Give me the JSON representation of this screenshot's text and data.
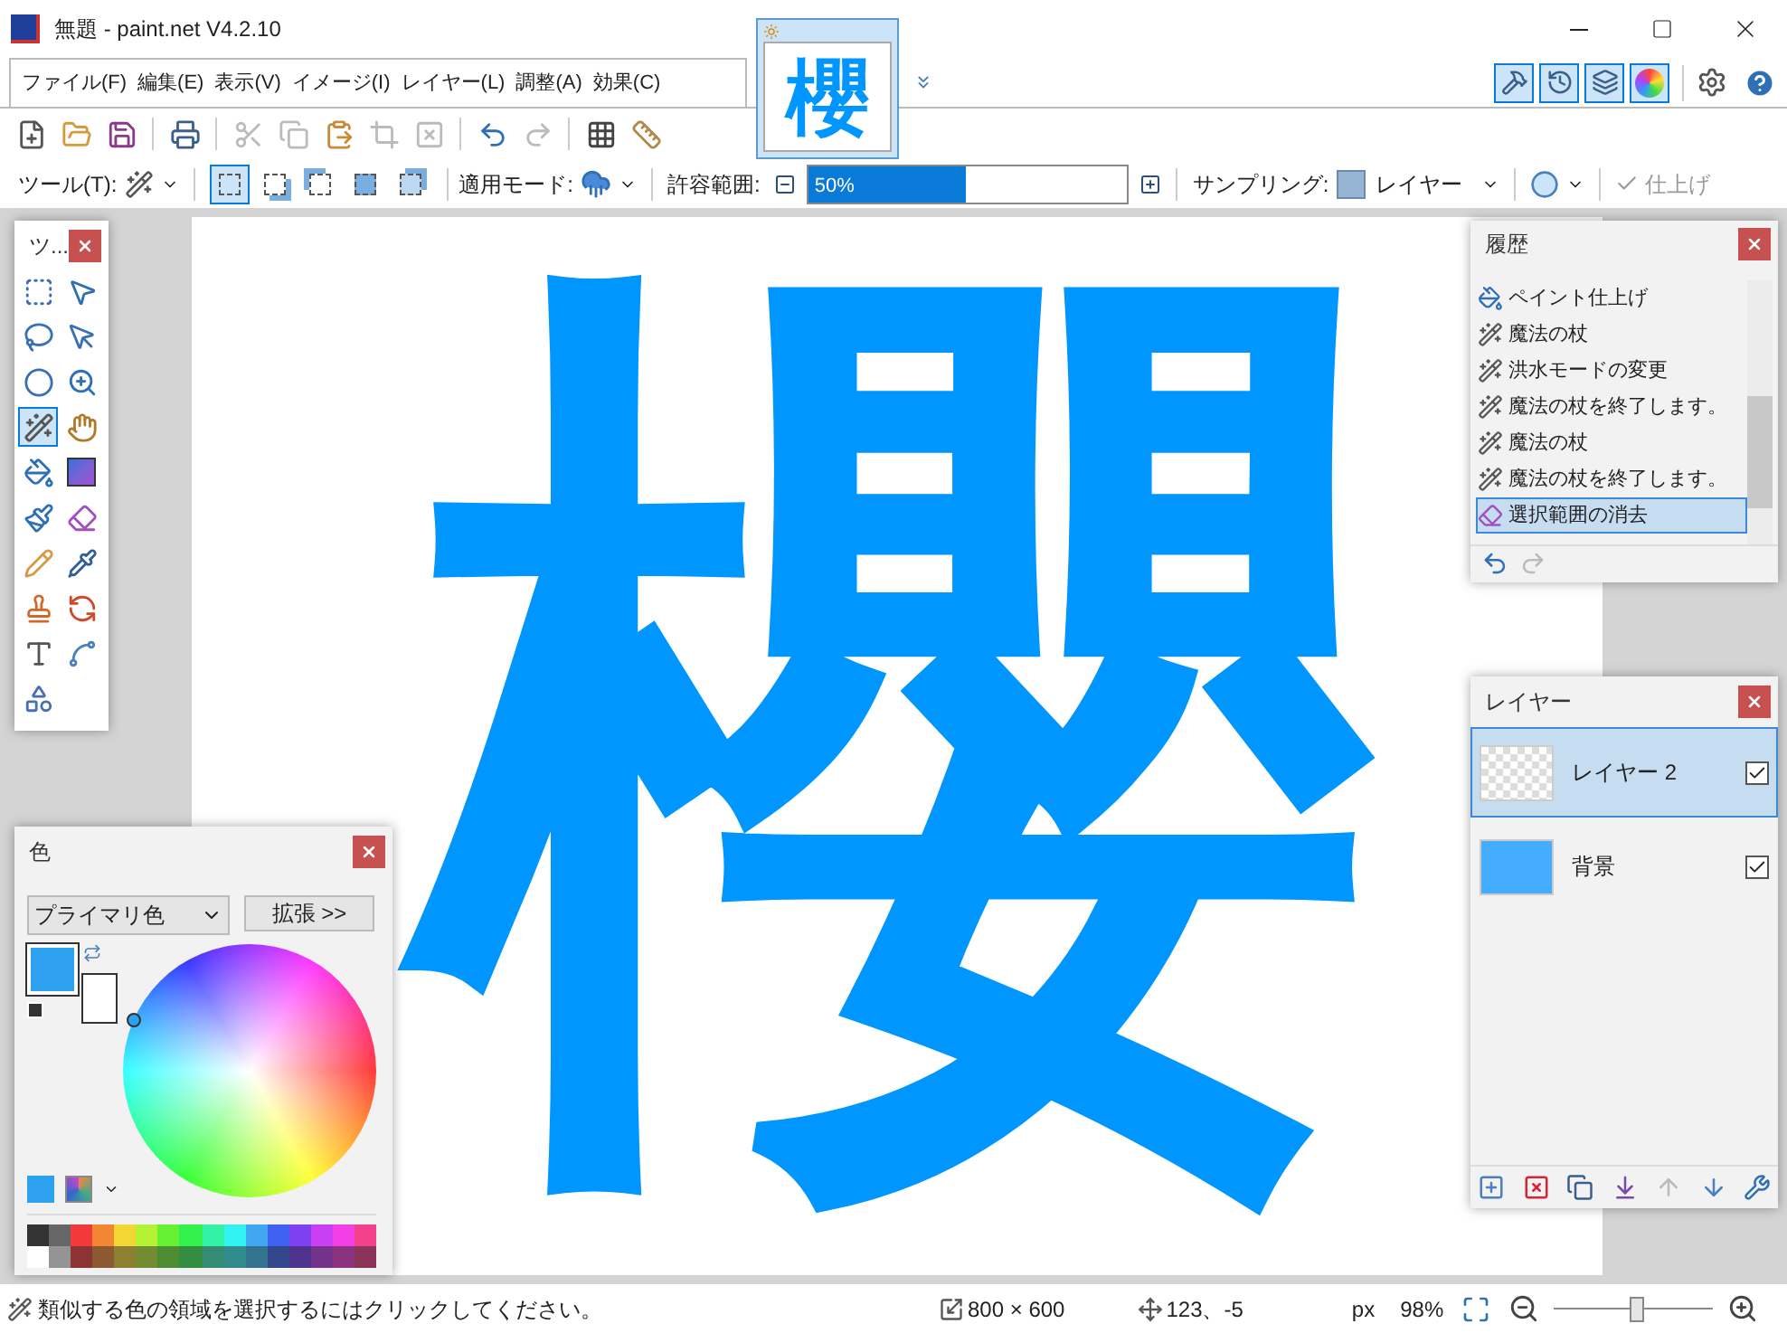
{
  "window": {
    "title": "無題 - paint.net V4.2.10"
  },
  "menu": [
    "ファイル(F)",
    "編集(E)",
    "表示(V)",
    "イメージ(I)",
    "レイヤー(L)",
    "調整(A)",
    "効果(C)"
  ],
  "image_tabs": [
    {
      "glyph": "櫻",
      "selected": true,
      "unsaved": true
    }
  ],
  "panel_toggles": [
    {
      "kind": "tools",
      "selected": true
    },
    {
      "kind": "history",
      "selected": true
    },
    {
      "kind": "layers",
      "selected": true
    },
    {
      "kind": "colors",
      "selected": true
    }
  ],
  "toolbar": [
    {
      "kind": "new",
      "disabled": false
    },
    {
      "kind": "open",
      "disabled": false
    },
    {
      "kind": "save",
      "disabled": false
    },
    {
      "kind": "print",
      "disabled": false
    },
    {
      "kind": "cut",
      "disabled": true
    },
    {
      "kind": "copy",
      "disabled": true
    },
    {
      "kind": "paste",
      "disabled": false
    },
    {
      "kind": "crop",
      "disabled": true
    },
    {
      "kind": "deselect",
      "disabled": true
    },
    {
      "kind": "undo",
      "disabled": false
    },
    {
      "kind": "redo",
      "disabled": true
    },
    {
      "kind": "grid",
      "disabled": false
    },
    {
      "kind": "ruler",
      "disabled": false
    }
  ],
  "options_bar": {
    "tool_label": "ツール(T):",
    "selection_modes": [
      {
        "kind": "replace",
        "selected": true
      },
      {
        "kind": "union",
        "selected": false
      },
      {
        "kind": "exclude",
        "selected": false
      },
      {
        "kind": "intersect",
        "selected": false
      },
      {
        "kind": "xor",
        "selected": false
      }
    ],
    "flood_mode_label": "適用モード:",
    "tolerance_label": "許容範囲:",
    "tolerance": {
      "level": 0.49,
      "reading": "50%"
    },
    "sampling_label": "サンプリング:",
    "sampling_value": "レイヤー",
    "finish": {
      "label": "仕上げ",
      "disabled": true
    }
  },
  "canvas": {
    "glyph": "櫻"
  },
  "tools_panel": {
    "title": "ツ...",
    "tools": [
      {
        "kind": "rect-select",
        "selected": false
      },
      {
        "kind": "move-pixels",
        "selected": false
      },
      {
        "kind": "lasso",
        "selected": false
      },
      {
        "kind": "move-selection",
        "selected": false
      },
      {
        "kind": "ellipse-select",
        "selected": false
      },
      {
        "kind": "zoom",
        "selected": false
      },
      {
        "kind": "magic-wand",
        "selected": true
      },
      {
        "kind": "pan",
        "selected": false
      },
      {
        "kind": "bucket",
        "selected": false
      },
      {
        "kind": "gradient",
        "selected": false
      },
      {
        "kind": "brush",
        "selected": false
      },
      {
        "kind": "eraser",
        "selected": false
      },
      {
        "kind": "pencil",
        "selected": false
      },
      {
        "kind": "picker",
        "selected": false
      },
      {
        "kind": "stamp",
        "selected": false
      },
      {
        "kind": "recolor",
        "selected": false
      },
      {
        "kind": "text",
        "selected": false
      },
      {
        "kind": "line",
        "selected": false
      },
      {
        "kind": "shapes",
        "selected": false
      }
    ]
  },
  "history_panel": {
    "title": "履歴",
    "items": [
      {
        "kind": "bucket",
        "label": "ペイント仕上げ",
        "selected": false
      },
      {
        "kind": "wand",
        "label": "魔法の杖",
        "selected": false
      },
      {
        "kind": "wand",
        "label": "洪水モードの変更",
        "selected": false
      },
      {
        "kind": "wand",
        "label": "魔法の杖を終了します。",
        "selected": false
      },
      {
        "kind": "wand",
        "label": "魔法の杖",
        "selected": false
      },
      {
        "kind": "wand",
        "label": "魔法の杖を終了します。",
        "selected": false
      },
      {
        "kind": "erase",
        "label": "選択範囲の消去",
        "selected": true
      }
    ]
  },
  "layers_panel": {
    "title": "レイヤー",
    "layers": [
      {
        "name": "レイヤー 2",
        "kind": "transparent",
        "selected": true,
        "visible": true
      },
      {
        "name": "背景",
        "kind": "solid",
        "selected": false,
        "visible": true
      }
    ]
  },
  "colors_panel": {
    "title": "色",
    "mode": "プライマリ色",
    "more_button": "拡張 >>",
    "palette": [
      {
        "color": "#333333"
      },
      {
        "color": "#666666"
      },
      {
        "color": "#f23a3a"
      },
      {
        "color": "#f28633"
      },
      {
        "color": "#f2d633"
      },
      {
        "color": "#b5f233"
      },
      {
        "color": "#66f233"
      },
      {
        "color": "#33f24d"
      },
      {
        "color": "#33f2a8"
      },
      {
        "color": "#33f2f2"
      },
      {
        "color": "#40a6f2"
      },
      {
        "color": "#4062f2"
      },
      {
        "color": "#7f40f2"
      },
      {
        "color": "#c940f2"
      },
      {
        "color": "#f240e6"
      },
      {
        "color": "#f2408a"
      },
      {
        "color": "#ffffff"
      },
      {
        "color": "#949494"
      },
      {
        "color": "#8c3333"
      },
      {
        "color": "#8c5933"
      },
      {
        "color": "#8c8033"
      },
      {
        "color": "#738c33"
      },
      {
        "color": "#4d8c33"
      },
      {
        "color": "#338c40"
      },
      {
        "color": "#338c73"
      },
      {
        "color": "#338c8c"
      },
      {
        "color": "#33738c"
      },
      {
        "color": "#33468c"
      },
      {
        "color": "#4d338c"
      },
      {
        "color": "#73338c"
      },
      {
        "color": "#8c3380"
      },
      {
        "color": "#8c3359"
      }
    ]
  },
  "status_bar": {
    "hint": "類似する色の領域を選択するにはクリックしてください。",
    "size": "800 × 600",
    "cursor": "123、-5",
    "unit": "px",
    "zoom": "98%",
    "zoom_slider": {
      "level": 0.52
    }
  }
}
